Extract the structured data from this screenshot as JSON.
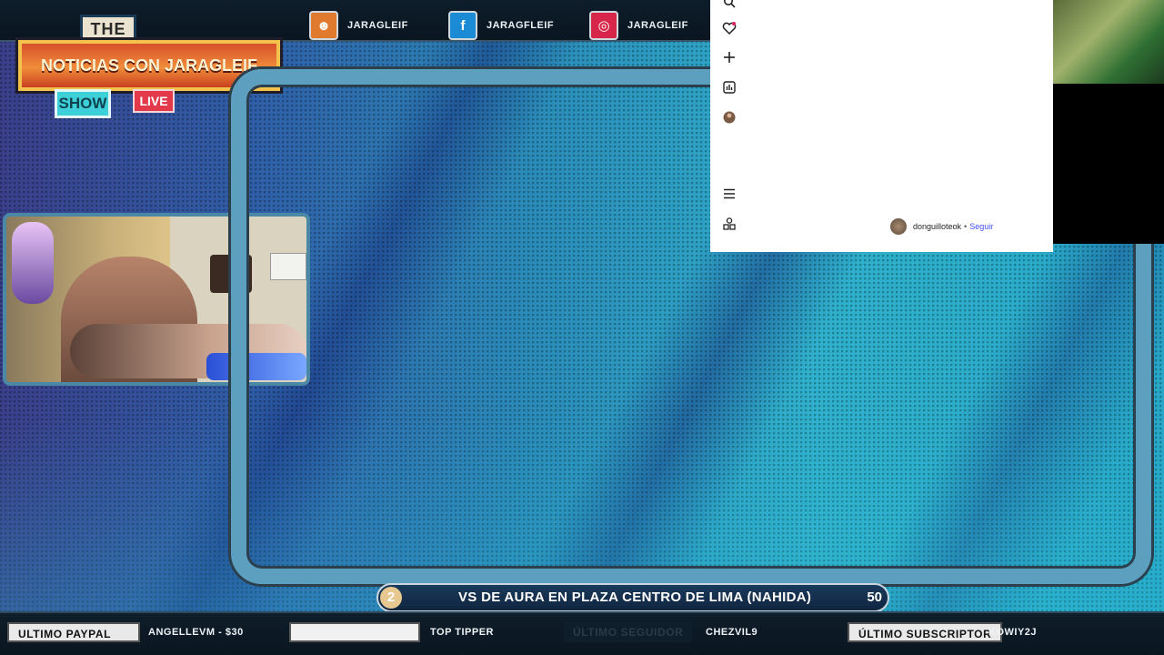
{
  "logo": {
    "the": "THE",
    "title": "NOTICIAS CON JARAGLEIF",
    "show": "SHOW",
    "live": "LIVE"
  },
  "socials": [
    {
      "icon": "discord-icon",
      "glyph": "☻",
      "color": "#e07a2e",
      "label": "JARAGLEIF"
    },
    {
      "icon": "facebook-icon",
      "glyph": "f",
      "color": "#1b8bd6",
      "label": "JARAGFLEIF"
    },
    {
      "icon": "instagram-icon",
      "glyph": "◎",
      "color": "#d7264a",
      "label": "JARAGLEIF"
    }
  ],
  "browser": {
    "sidebar_icons": [
      "search-icon",
      "heart-icon",
      "create-plus-icon",
      "stats-icon",
      "profile-icon",
      "menu-icon",
      "apps-icon"
    ],
    "follow": {
      "username": "donguilloteok",
      "separator": "•",
      "action": "Seguir"
    }
  },
  "event": {
    "number": "2",
    "title": "VS DE AURA EN PLAZA CENTRO DE LIMA (NAHIDA)",
    "count": "50"
  },
  "ticker": {
    "paypal_label": "ULTIMO PAYPAL",
    "paypal_value": "ANGELLEVM - $30",
    "tipper_label": "TOP TIPPER",
    "follower_label": "ÚLTIMO SEGUIDOR",
    "follower_value": "CHEZVIL9",
    "subscriber_label": "ÚLTIMO SUBSCRIPTOR",
    "subscriber_value": "KOWIY2J"
  }
}
